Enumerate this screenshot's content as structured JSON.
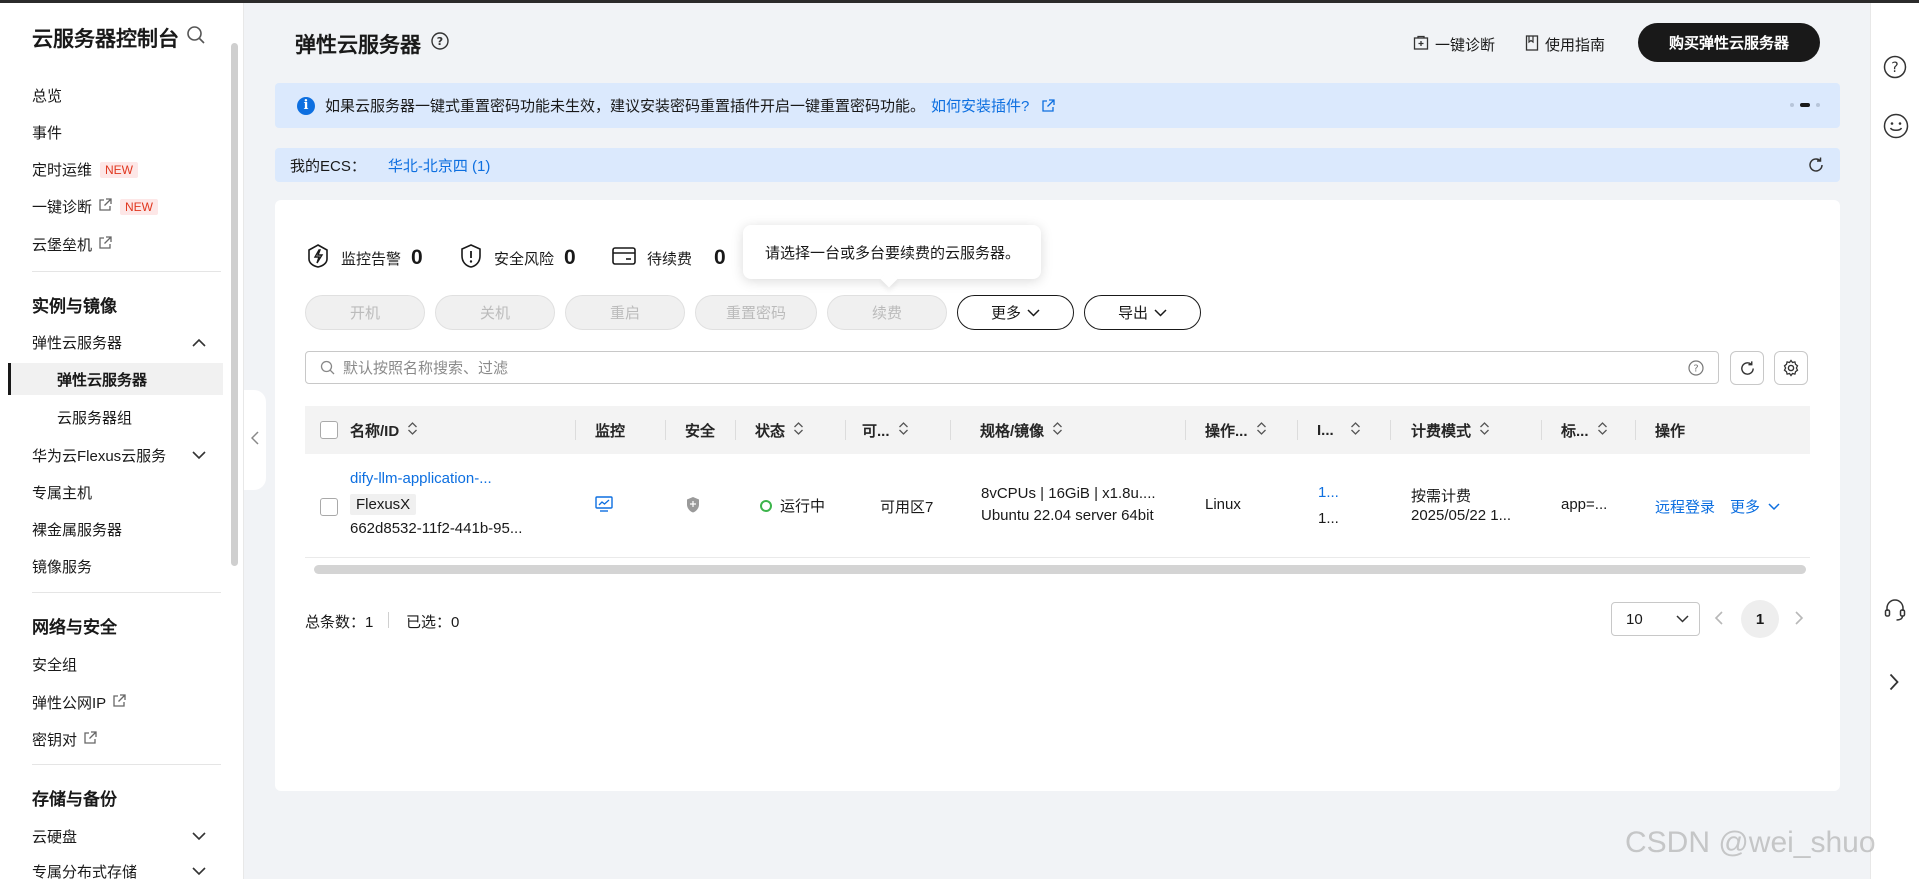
{
  "sidebar": {
    "title": "云服务器控制台",
    "top_items": [
      {
        "label": "总览"
      },
      {
        "label": "事件"
      },
      {
        "label": "定时运维",
        "badge": "NEW"
      },
      {
        "label": "一键诊断",
        "badge": "NEW"
      },
      {
        "label": "云堡垒机"
      }
    ],
    "group1": "实例与镜像",
    "ecs_parent": "弹性云服务器",
    "ecs_active": "弹性云服务器",
    "ecs_group": "云服务器组",
    "flexus": "华为云Flexus云服务",
    "dedicated_host": "专属主机",
    "bms": "裸金属服务器",
    "image": "镜像服务",
    "group2": "网络与安全",
    "sec_group": "安全组",
    "eip": "弹性公网IP",
    "keypair": "密钥对",
    "group3": "存储与备份",
    "evs": "云硬盘",
    "dss": "专属分布式存储"
  },
  "header": {
    "title": "弹性云服务器",
    "diagnose": "一键诊断",
    "guide": "使用指南",
    "buy": "购买弹性云服务器"
  },
  "notice": {
    "text": "如果云服务器一键式重置密码功能未生效，建议安装密码重置插件开启一键重置密码功能。",
    "link": "如何安装插件?"
  },
  "myecs": {
    "label": "我的ECS：",
    "region": "华北-北京四 (1)"
  },
  "stats": [
    {
      "label": "监控告警",
      "value": "0"
    },
    {
      "label": "安全风险",
      "value": "0"
    },
    {
      "label": "待续费",
      "value": "0"
    }
  ],
  "tooltip": "请选择一台或多台要续费的云服务器。",
  "actions": {
    "start": "开机",
    "stop": "关机",
    "restart": "重启",
    "reset_pwd": "重置密码",
    "renew": "续费",
    "more": "更多",
    "export": "导出"
  },
  "search": {
    "placeholder": "默认按照名称搜索、过滤"
  },
  "table": {
    "headers": {
      "name": "名称/ID",
      "monitor": "监控",
      "security": "安全",
      "status": "状态",
      "az": "可...",
      "spec": "规格/镜像",
      "os": "操作...",
      "ip": "I...",
      "billing": "计费模式",
      "tag": "标...",
      "ops": "操作"
    },
    "row": {
      "name": "dify-llm-application-...",
      "tag": "FlexusX",
      "id": "662d8532-11f2-441b-95...",
      "status": "运行中",
      "az": "可用区7",
      "spec": "8vCPUs | 16GiB | x1.8u....",
      "image": "Ubuntu 22.04 server 64bit",
      "os": "Linux",
      "ip1": "1...",
      "ip2": "1...",
      "billing": "按需计费",
      "billing_date": "2025/05/22 1...",
      "tags": "app=...",
      "remote": "远程登录",
      "more": "更多"
    }
  },
  "footer": {
    "total_label": "总条数：",
    "total": "1",
    "selected_label": "已选：",
    "selected": "0",
    "page_size": "10",
    "page": "1"
  },
  "watermark": "CSDN @wei_shuo"
}
